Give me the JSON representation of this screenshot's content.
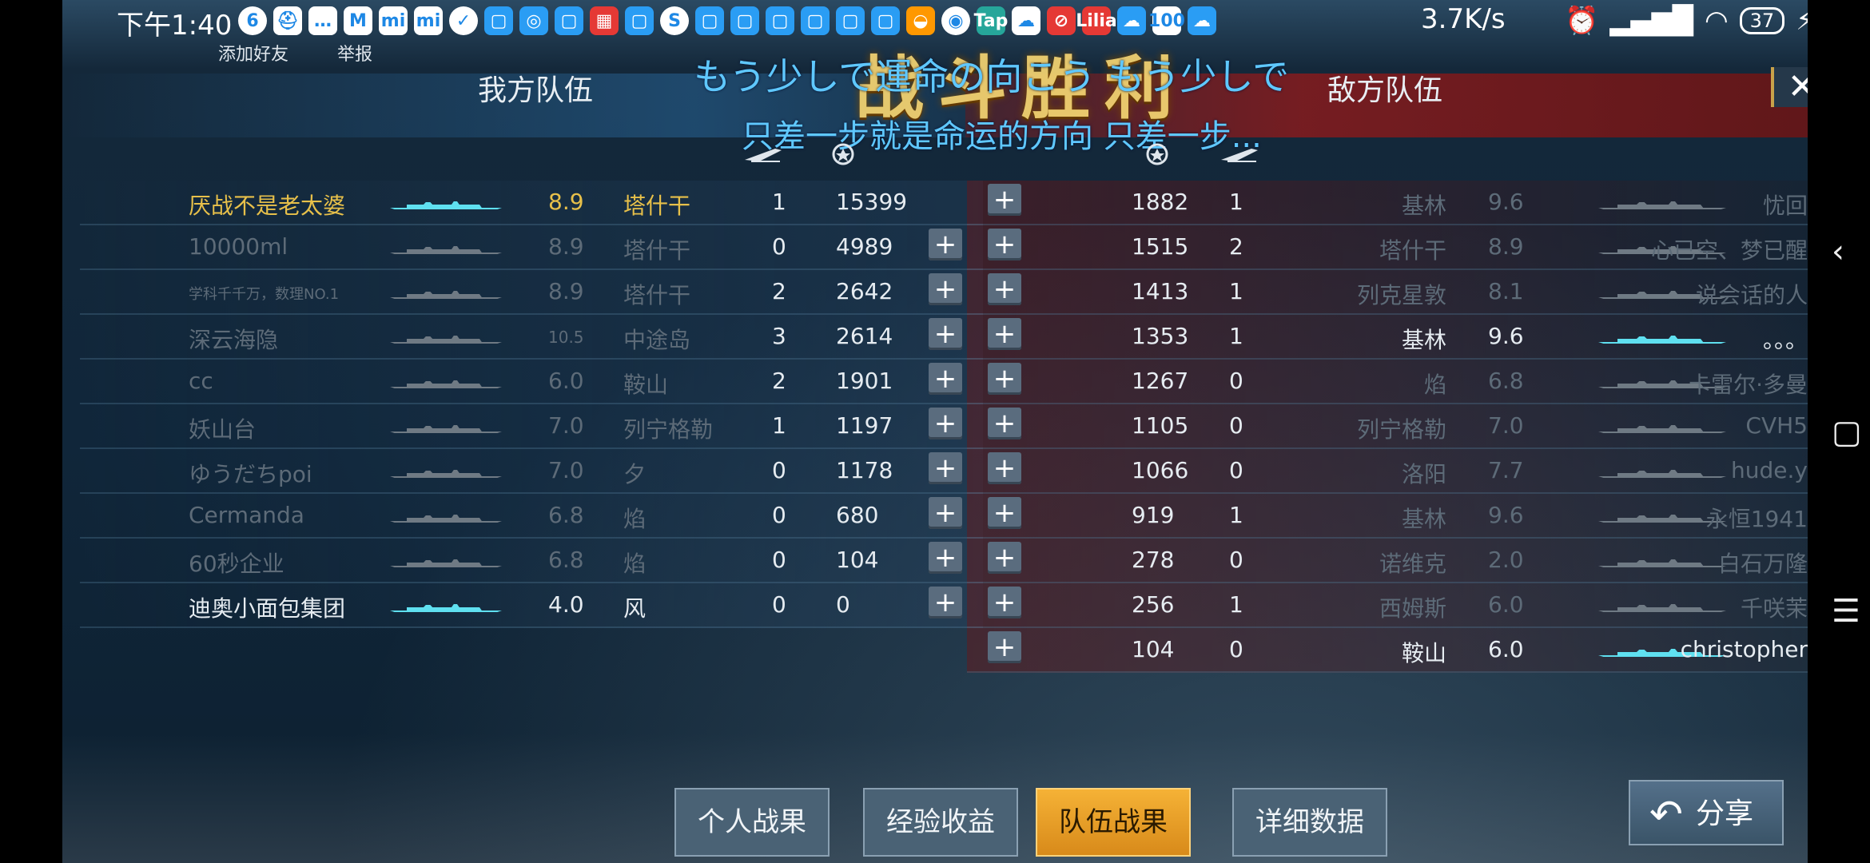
{
  "status_bar": {
    "time": "下午1:40",
    "speed": "3.7K/s",
    "battery": "37",
    "icons": [
      "6",
      "⛑",
      "…",
      "M",
      "mi",
      "mi",
      "✓",
      "▢",
      "◎",
      "▢",
      "▦",
      "▢",
      "S",
      "▢",
      "▢",
      "▢",
      "▢",
      "▢",
      "▢",
      "◒",
      "◉",
      "Tap",
      "☁",
      "⊘",
      "Lilia",
      "☁",
      "100",
      "☁"
    ]
  },
  "header": {
    "links": [
      "添加好友",
      "举报"
    ],
    "victory": "战斗胜利",
    "team_ours": "我方队伍",
    "team_enemy": "敌方队伍",
    "close": "✕"
  },
  "subtitles": {
    "jp": "もう少しで運命の向こう  もう少しで",
    "cn": "只差一步就是命运的方向  只差一步..."
  },
  "colors": {
    "gold": "#e7c04a",
    "cyan": "#5fe0f0",
    "blue_sub": "#5fc8ff",
    "tab_active": "#f5b236"
  },
  "our_team": [
    {
      "name": "厌战不是老太婆",
      "tier": "8.9",
      "ship": "塔什干",
      "kills": "1",
      "score": "15399",
      "style": "gold",
      "plus": false
    },
    {
      "name": "10000ml",
      "tier": "8.9",
      "ship": "塔什干",
      "kills": "0",
      "score": "4989",
      "style": "dim",
      "plus": true
    },
    {
      "name": "学科千千万，数理NO.1",
      "tier": "8.9",
      "ship": "塔什干",
      "kills": "2",
      "score": "2642",
      "style": "dim",
      "plus": true,
      "small": true
    },
    {
      "name": "深云海隐",
      "tier": "10.5",
      "ship": "中途岛",
      "kills": "3",
      "score": "2614",
      "style": "dim",
      "plus": true
    },
    {
      "name": "cc",
      "tier": "6.0",
      "ship": "鞍山",
      "kills": "2",
      "score": "1901",
      "style": "dim",
      "plus": true
    },
    {
      "name": "妖山台",
      "tier": "7.0",
      "ship": "列宁格勒",
      "kills": "1",
      "score": "1197",
      "style": "dim",
      "plus": true
    },
    {
      "name": "ゆうだちpoi",
      "tier": "7.0",
      "ship": "夕",
      "kills": "0",
      "score": "1178",
      "style": "dim",
      "plus": true
    },
    {
      "name": "Cermanda",
      "tier": "6.8",
      "ship": "焰",
      "kills": "0",
      "score": "680",
      "style": "dim",
      "plus": true
    },
    {
      "name": "60秒企业",
      "tier": "6.8",
      "ship": "焰",
      "kills": "0",
      "score": "104",
      "style": "dim",
      "plus": true
    },
    {
      "name": "迪奥小面包集团",
      "tier": "4.0",
      "ship": "风",
      "kills": "0",
      "score": "0",
      "style": "bright",
      "plus": true
    }
  ],
  "enemy_team": [
    {
      "score": "1882",
      "kills": "1",
      "ship": "基林",
      "tier": "9.6",
      "name": "忧回",
      "style": "dim"
    },
    {
      "score": "1515",
      "kills": "2",
      "ship": "塔什干",
      "tier": "8.9",
      "name": "心已空、梦已醒",
      "style": "dim"
    },
    {
      "score": "1413",
      "kills": "1",
      "ship": "列克星敦",
      "tier": "8.1",
      "name": "说会话的人",
      "style": "dim"
    },
    {
      "score": "1353",
      "kills": "1",
      "ship": "基林",
      "tier": "9.6",
      "name": "。。。",
      "style": "bright"
    },
    {
      "score": "1267",
      "kills": "0",
      "ship": "焰",
      "tier": "6.8",
      "name": "卡雷尔·多曼",
      "style": "dim"
    },
    {
      "score": "1105",
      "kills": "0",
      "ship": "列宁格勒",
      "tier": "7.0",
      "name": "CVH5",
      "style": "dim"
    },
    {
      "score": "1066",
      "kills": "0",
      "ship": "洛阳",
      "tier": "7.7",
      "name": "hude.y",
      "style": "dim"
    },
    {
      "score": "919",
      "kills": "1",
      "ship": "基林",
      "tier": "9.6",
      "name": "永恒1941",
      "style": "dim"
    },
    {
      "score": "278",
      "kills": "0",
      "ship": "诺维克",
      "tier": "2.0",
      "name": "白石万隆",
      "style": "dim"
    },
    {
      "score": "256",
      "kills": "1",
      "ship": "西姆斯",
      "tier": "6.0",
      "name": "千咲茉",
      "style": "dim"
    },
    {
      "score": "104",
      "kills": "0",
      "ship": "鞍山",
      "tier": "6.0",
      "name": "christopher",
      "style": "bright"
    }
  ],
  "tabs": [
    {
      "label": "个人战果",
      "active": false
    },
    {
      "label": "经验收益",
      "active": false
    },
    {
      "label": "队伍战果",
      "active": true
    },
    {
      "label": "详细数据",
      "active": false
    }
  ],
  "share_label": "分享"
}
